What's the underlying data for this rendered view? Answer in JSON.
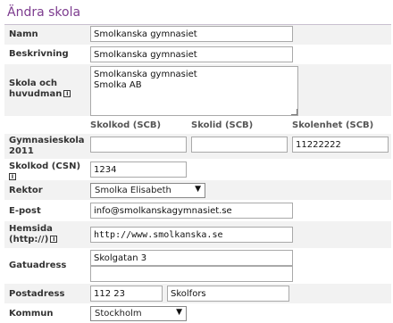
{
  "page_title": "Ändra skola",
  "fields": {
    "namn_label": "Namn",
    "namn_value": "Smolkanska gymnasiet",
    "beskrivning_label": "Beskrivning",
    "beskrivning_value": "Smolkanska gymnasiet",
    "skola_huvudman_label_1": "Skola och",
    "skola_huvudman_label_2": "huvudman",
    "skola_huvudman_value": "Smolkanska gymnasiet\nSmolka AB",
    "col_skolkod": "Skolkod (SCB)",
    "col_skolid": "Skolid (SCB)",
    "col_skolenhet": "Skolenhet (SCB)",
    "gymnasieskola_label_1": "Gymnasieskola",
    "gymnasieskola_label_2": "2011",
    "skolkod_scb_value": "",
    "skolid_scb_value": "",
    "skolenhet_scb_value": "11222222",
    "skolkod_csn_label": "Skolkod (CSN)",
    "skolkod_csn_value": "1234",
    "rektor_label": "Rektor",
    "rektor_value": "Smolka Elisabeth",
    "epost_label": "E-post",
    "epost_value": "info@smolkanskagymnasiet.se",
    "hemsida_label_1": "Hemsida",
    "hemsida_label_2": "(http://)",
    "hemsida_value": "http://www.smolkanska.se",
    "gatuadress_label": "Gatuadress",
    "gatuadress_value_1": "Skolgatan 3",
    "gatuadress_value_2": "",
    "postadress_label": "Postadress",
    "postnummer_value": "112 23",
    "ort_value": "Skolfors",
    "kommun_label": "Kommun",
    "kommun_value": "Stockholm"
  },
  "icons": {
    "info": "info-icon",
    "dropdown": "chevron-down-icon"
  },
  "colors": {
    "title": "#7d3c8f",
    "row_alt": "#f2f2f2"
  }
}
